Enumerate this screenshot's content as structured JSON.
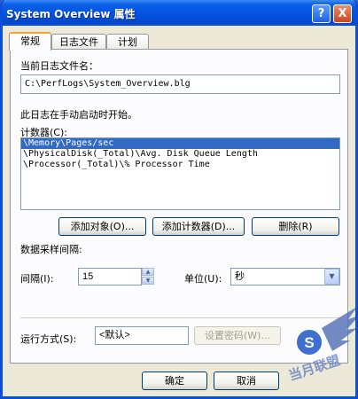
{
  "window": {
    "title": "System Overview 属性",
    "help_glyph": "?",
    "close_glyph": "X"
  },
  "tabs": [
    {
      "label": "常规"
    },
    {
      "label": "日志文件"
    },
    {
      "label": "计划"
    }
  ],
  "general": {
    "log_file_label": "当前日志文件名：",
    "log_file_value": "C:\\PerfLogs\\System_Overview.blg",
    "status_text": "此日志在手动启动时开始。",
    "counters_label": "计数器(C):",
    "counters": [
      "\\Memory\\Pages/sec",
      "\\PhysicalDisk(_Total)\\Avg. Disk Queue Length",
      "\\Processor(_Total)\\% Processor Time"
    ],
    "add_objects_label": "添加对象(O)...",
    "add_counters_label": "添加计数器(D)...",
    "remove_label": "删除(R)",
    "sampling_label": "数据采样间隔:",
    "interval_label": "间隔(I):",
    "interval_value": "15",
    "units_label": "单位(U):",
    "units_value": "秒",
    "run_as_label": "运行方式(S):",
    "run_as_value": "<默认>",
    "set_password_label": "设置密码(W)..."
  },
  "footer": {
    "ok_label": "确定",
    "cancel_label": "取消"
  },
  "watermark": {
    "text": "当月联盟"
  }
}
